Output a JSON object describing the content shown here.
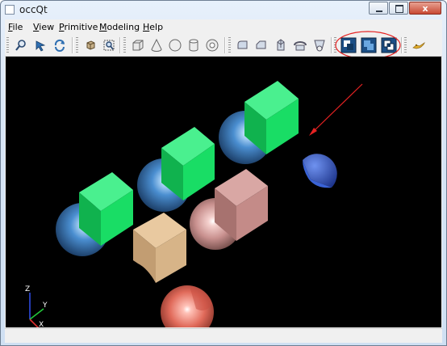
{
  "window": {
    "title": "occQt",
    "buttons": {
      "minimize": "minimize",
      "maximize": "maximize",
      "close": "x"
    }
  },
  "menu": [
    "File",
    "View",
    "Primitive",
    "Modeling",
    "Help"
  ],
  "menu_mnemonic": [
    "F",
    "V",
    "P",
    "M",
    "H"
  ],
  "toolbar": {
    "view_tools": [
      "zoom-icon",
      "pan-icon",
      "rotate-icon"
    ],
    "fit_tools": [
      "fit-all-icon",
      "fit-area-icon"
    ],
    "primitive_tools": [
      "box-icon",
      "cone-icon",
      "sphere-icon",
      "cylinder-icon",
      "torus-icon"
    ],
    "modeling_tools": [
      "fillet-icon",
      "chamfer-icon",
      "extrude-icon",
      "revolve-icon",
      "loft-icon"
    ],
    "boolean_tools": [
      "cut-icon",
      "fuse-icon",
      "common-icon"
    ],
    "help_tools": [
      "about-icon"
    ]
  },
  "axis_labels": {
    "z": "Z",
    "y": "Y",
    "x": "X"
  },
  "colors": {
    "highlight": "#e52222",
    "boolean_button": "#1c4f86",
    "viewport_background": "#000000",
    "box_green": "#16d760",
    "sphere_blue": "#4a8ed0",
    "tan_solid": "#d6b48c",
    "pink_solid": "#c9918f",
    "red_sphere": "#e06a5a",
    "blue_hemisphere": "#2f55c8"
  }
}
